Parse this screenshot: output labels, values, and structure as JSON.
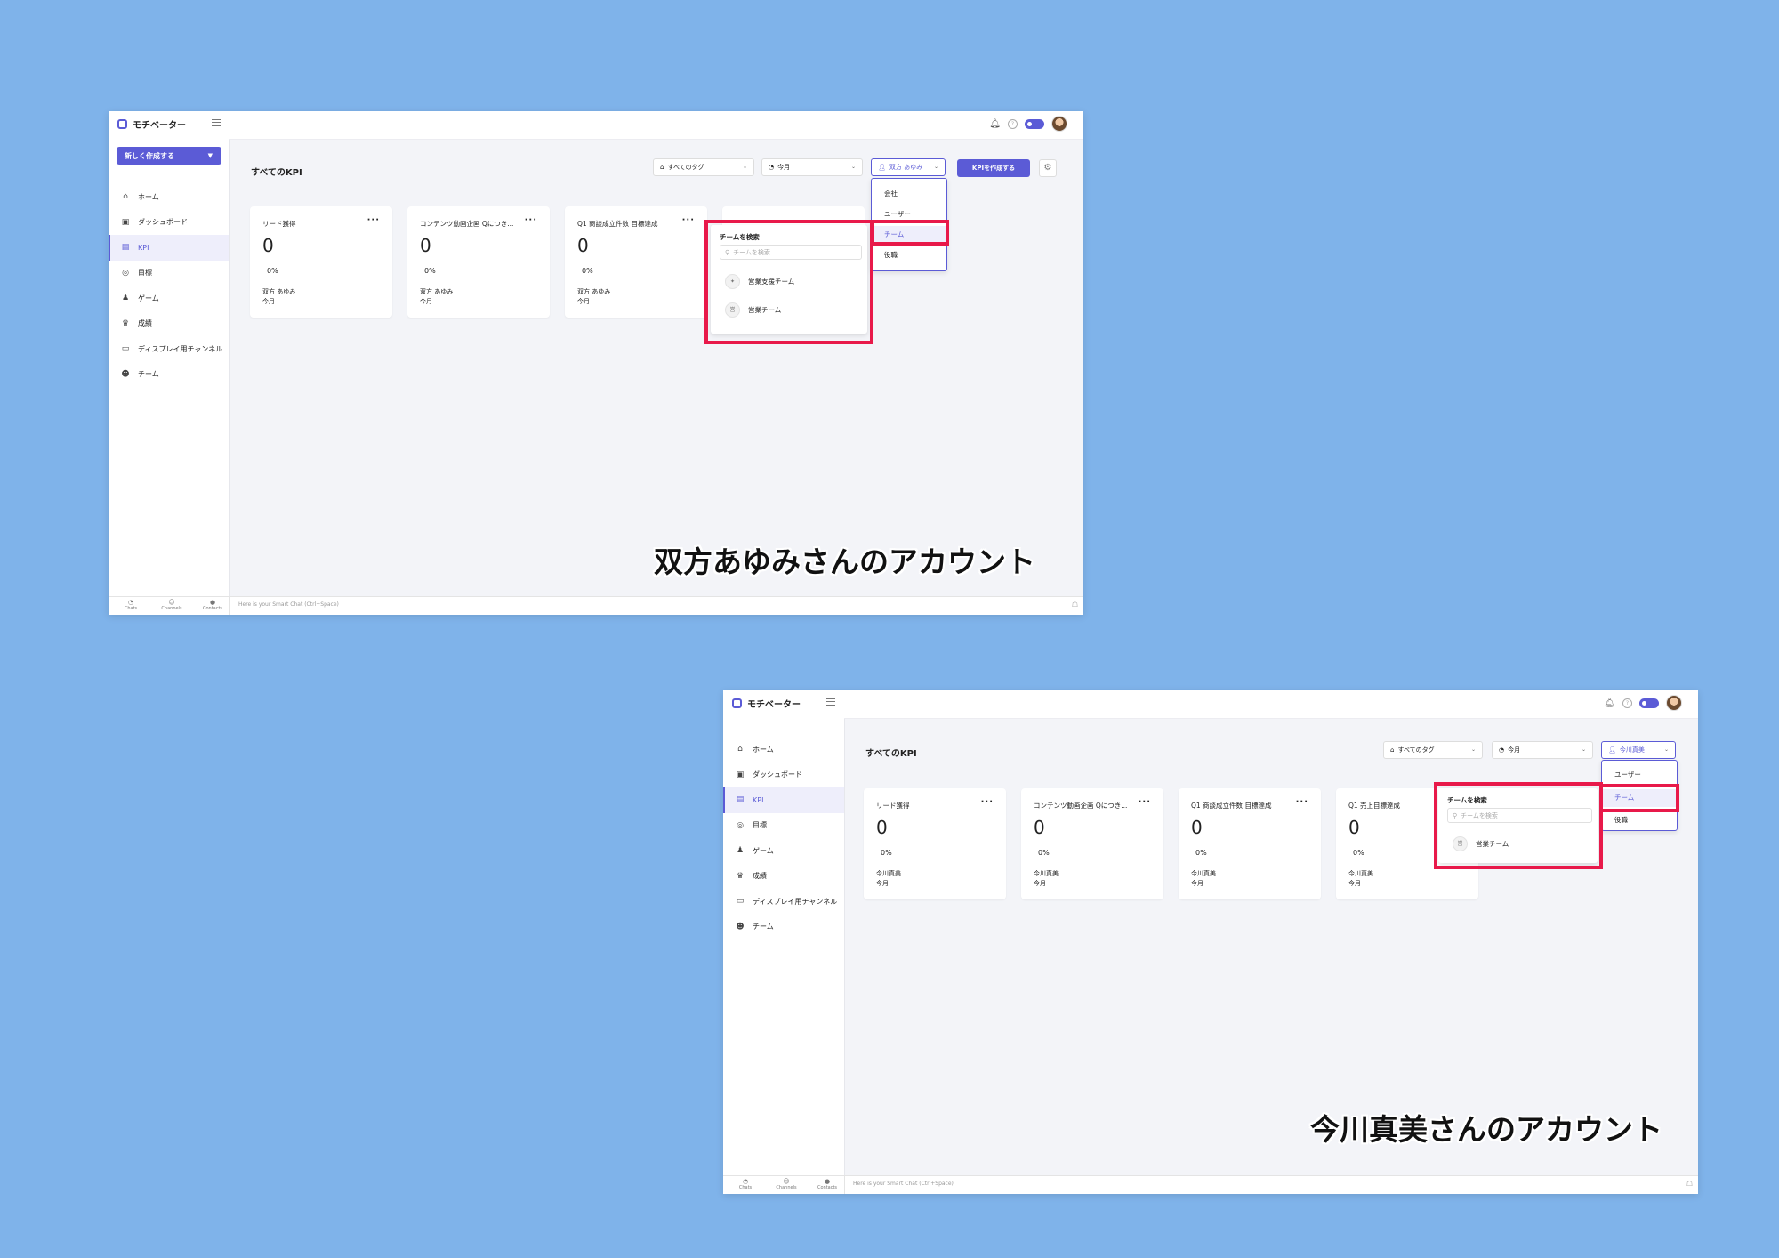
{
  "app": {
    "brand": "モチベーター",
    "create_button": "新しく作成する",
    "page_title": "すべてのKPI",
    "nav": [
      {
        "label": "ホーム",
        "icon": "home-icon",
        "glyph": "⌂"
      },
      {
        "label": "ダッシュボード",
        "icon": "dashboard-icon",
        "glyph": "▣"
      },
      {
        "label": "KPI",
        "icon": "kpi-icon",
        "glyph": "▤"
      },
      {
        "label": "目標",
        "icon": "target-icon",
        "glyph": "◎"
      },
      {
        "label": "ゲーム",
        "icon": "game-icon",
        "glyph": "♟"
      },
      {
        "label": "成績",
        "icon": "trophy-icon",
        "glyph": "♛"
      },
      {
        "label": "ディスプレイ用チャンネル",
        "icon": "display-icon",
        "glyph": "▭"
      },
      {
        "label": "チーム",
        "icon": "team-icon",
        "glyph": "☻"
      }
    ],
    "filter_tags": "すべてのタグ",
    "filter_period": "今月",
    "create_kpi_button": "KPIを作成する",
    "team_search_title": "チームを検索",
    "team_search_placeholder": "チームを検索",
    "bottom_tabs": [
      "Chats",
      "Channels",
      "Contacts"
    ],
    "smart_chat_placeholder": "Here is your Smart Chat (Ctrl+Space)",
    "accent_color": "#5b5bd6",
    "highlight_color": "#e8194a",
    "background_color": "#7fb3ea"
  },
  "screen1": {
    "caption": "双方あゆみさんのアカウント",
    "user_filter": "双方 あゆみ",
    "view_menu": [
      "会社",
      "ユーザー",
      "チーム",
      "役職"
    ],
    "selected_view": "チーム",
    "teams": [
      "営業支援チーム",
      "営業チーム"
    ],
    "cards": [
      {
        "title": "リード獲得",
        "value": "0",
        "percent": "0%",
        "owner": "双方 あゆみ",
        "period": "今月"
      },
      {
        "title": "コンテンツ動画企画 Qにつき...",
        "value": "0",
        "percent": "0%",
        "owner": "双方 あゆみ",
        "period": "今月"
      },
      {
        "title": "Q1 商談成立件数 目標達成",
        "value": "0",
        "percent": "0%",
        "owner": "双方 あゆみ",
        "period": "今月"
      }
    ]
  },
  "screen2": {
    "caption": "今川真美さんのアカウント",
    "user_filter": "今川真美",
    "view_menu": [
      "ユーザー",
      "チーム",
      "役職"
    ],
    "selected_view": "チーム",
    "teams": [
      "営業チーム"
    ],
    "cards": [
      {
        "title": "リード獲得",
        "value": "0",
        "percent": "0%",
        "owner": "今川真美",
        "period": "今月"
      },
      {
        "title": "コンテンツ動画企画 Qにつき...",
        "value": "0",
        "percent": "0%",
        "owner": "今川真美",
        "period": "今月"
      },
      {
        "title": "Q1 商談成立件数 目標達成",
        "value": "0",
        "percent": "0%",
        "owner": "今川真美",
        "period": "今月"
      },
      {
        "title": "Q1 売上目標達成",
        "value": "0",
        "percent": "0%",
        "owner": "今川真美",
        "period": "今月"
      }
    ]
  }
}
